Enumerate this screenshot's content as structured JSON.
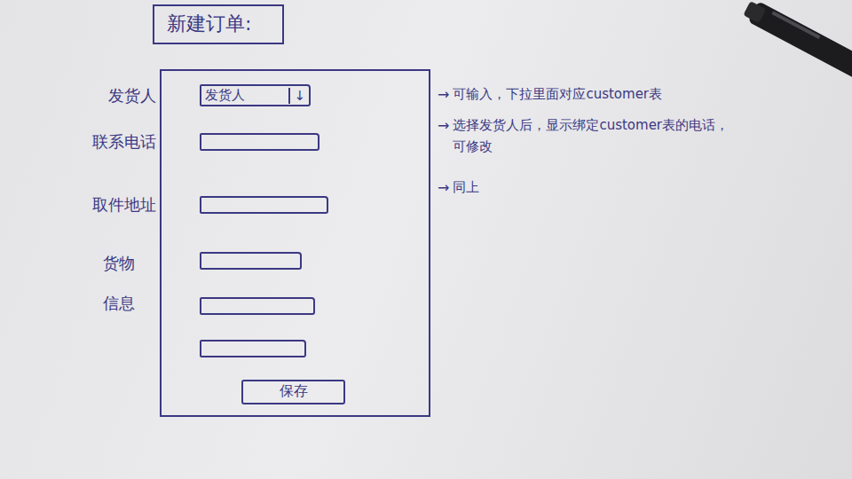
{
  "title": "新建订单:",
  "fields": [
    {
      "label": "发货人",
      "kind": "dropdown",
      "value": "发货人",
      "icon": "↓",
      "note": {
        "arrow": "→",
        "text": "可输入，下拉里面对应customer表"
      }
    },
    {
      "label": "联系电话",
      "kind": "input",
      "value": "",
      "note": {
        "arrow": "→",
        "text": "选择发货人后，显示绑定customer表的电话，可修改"
      }
    },
    {
      "label": "取件地址",
      "kind": "input",
      "value": "",
      "note": {
        "arrow": "→",
        "text": "同上"
      }
    }
  ],
  "goods": {
    "label": "货物信息",
    "values": [
      "",
      "",
      ""
    ]
  },
  "button": "保存"
}
